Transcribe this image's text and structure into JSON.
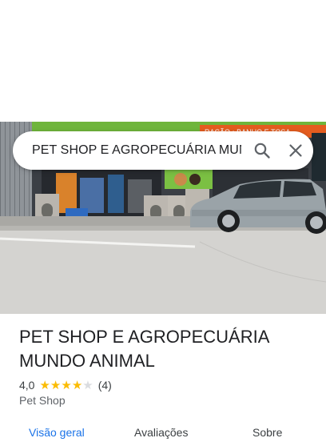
{
  "search": {
    "query": "PET SHOP E AGROPECUÁRIA MUNDO ANIMAL",
    "search_icon": "search-icon",
    "close_icon": "close-icon"
  },
  "photo": {
    "sign_text": "RAÇÃO • BANHO E TOSA"
  },
  "place": {
    "name": "PET SHOP E AGROPECUÁRIA MUNDO ANIMAL",
    "rating": "4,0",
    "stars": 4,
    "stars_max": 5,
    "review_count": "(4)",
    "category": "Pet Shop"
  },
  "tabs": [
    {
      "label": "Visão geral",
      "active": true
    },
    {
      "label": "Avaliações",
      "active": false
    },
    {
      "label": "Sobre",
      "active": false
    }
  ],
  "colors": {
    "accent": "#1a73e8",
    "star": "#fbbc04",
    "star_empty": "#dadce0"
  }
}
